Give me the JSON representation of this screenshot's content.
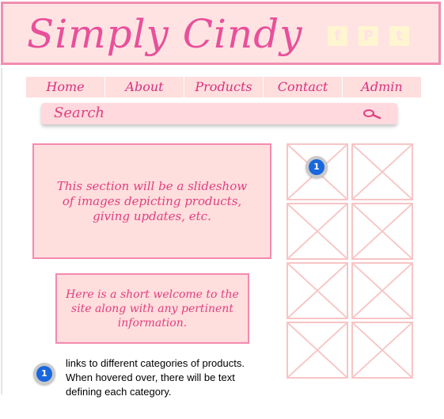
{
  "header": {
    "logo_text": "Simply Cindy",
    "social": [
      {
        "name": "facebook",
        "glyph": "f"
      },
      {
        "name": "pinterest",
        "glyph": "P"
      },
      {
        "name": "twitter",
        "glyph": "t"
      }
    ]
  },
  "nav": {
    "items": [
      {
        "label": "Home"
      },
      {
        "label": "About"
      },
      {
        "label": "Products"
      },
      {
        "label": "Contact"
      },
      {
        "label": "Admin"
      }
    ]
  },
  "search": {
    "label": "Search",
    "icon": "search-icon"
  },
  "slideshow": {
    "text": "This section will be a slideshow of images depicting products, giving updates, etc."
  },
  "welcome": {
    "text": "Here is a short welcome to the site along with any pertinent information."
  },
  "gallery": {
    "thumbnail_count": 8
  },
  "annotation": {
    "badge": "1",
    "note": "links to different categories of products. When hovered over, there will be text defining each category."
  },
  "colors": {
    "header_bg": "#ffe3e3",
    "header_border": "#f08eb0",
    "logo": "#e8509a",
    "nav_bg": "#ffdede",
    "accent_text": "#e0407f",
    "thumb_border": "#f7c5c5",
    "badge_blue": "#1867de"
  }
}
